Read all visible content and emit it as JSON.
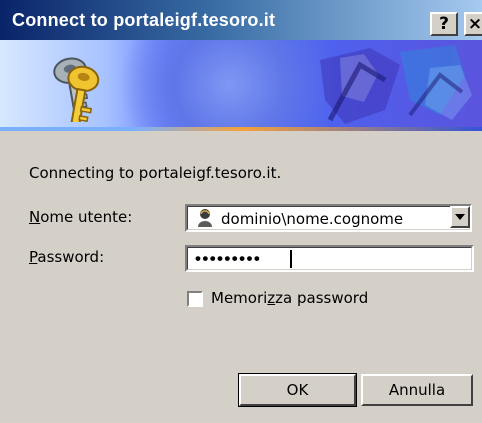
{
  "window": {
    "title": "Connect to portaleigf.tesoro.it",
    "help_button": "?",
    "close_button": "×"
  },
  "dialog": {
    "message": "Connecting to portaleigf.tesoro.it.",
    "username": {
      "label_prefix": "N",
      "label_rest": "ome utente:",
      "value": "dominio\\nome.cognome"
    },
    "password": {
      "label_prefix": "P",
      "label_rest": "assword:",
      "masked_value": "•••••••••"
    },
    "remember": {
      "label_before": "Memori",
      "label_underlined": "z",
      "label_after": "za password",
      "checked": false
    },
    "buttons": {
      "ok": "OK",
      "cancel": "Annulla"
    }
  },
  "icons": [
    "keys-icon",
    "user-icon",
    "dropdown-arrow-icon",
    "help-icon",
    "close-icon"
  ],
  "colors": {
    "titlebar_start": "#0a246a",
    "titlebar_end": "#a6caf0",
    "dialog_bg": "#d4d0c8",
    "banner_blue": "#4a64f2"
  }
}
